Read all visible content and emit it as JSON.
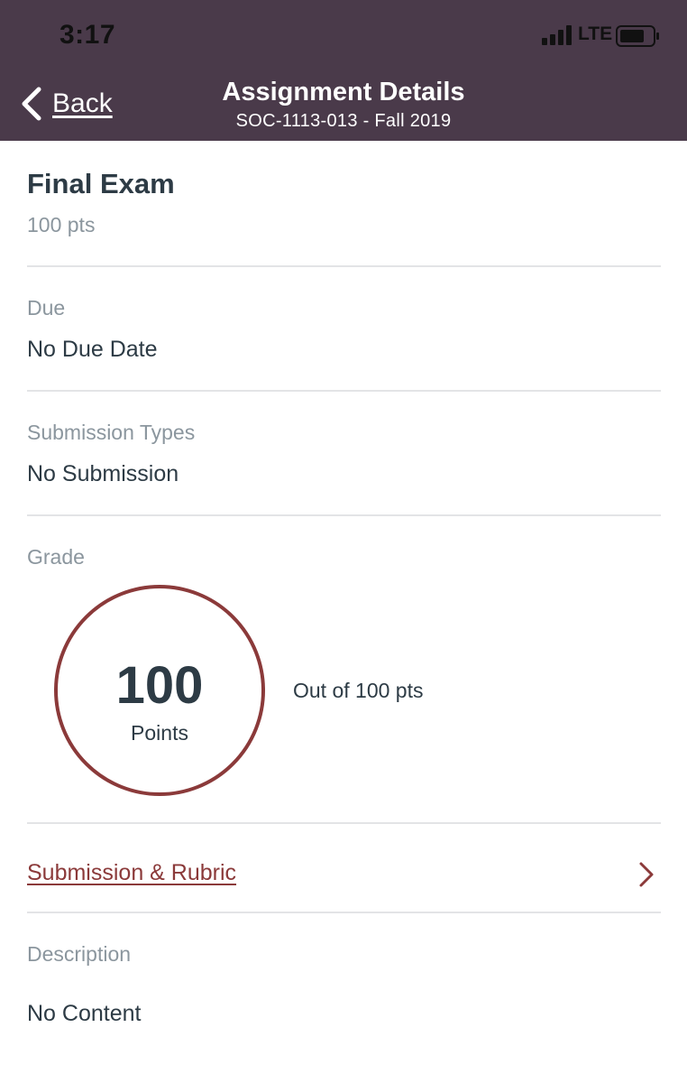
{
  "status_bar": {
    "time": "3:17",
    "network": "LTE"
  },
  "nav": {
    "back_label": "Back",
    "title": "Assignment Details",
    "subtitle": "SOC-1113-013 - Fall 2019"
  },
  "assignment": {
    "name": "Final Exam",
    "points": "100 pts"
  },
  "due": {
    "label": "Due",
    "value": "No Due Date"
  },
  "submission_types": {
    "label": "Submission Types",
    "value": "No Submission"
  },
  "grade": {
    "label": "Grade",
    "score": "100",
    "unit": "Points",
    "out_of": "Out of 100 pts"
  },
  "submission_rubric": {
    "label": "Submission & Rubric"
  },
  "description": {
    "label": "Description",
    "value": "No Content"
  },
  "colors": {
    "header_bg": "#4a3a4a",
    "accent": "#8b3a3a",
    "text": "#2d3b45",
    "muted": "#8b969e"
  }
}
